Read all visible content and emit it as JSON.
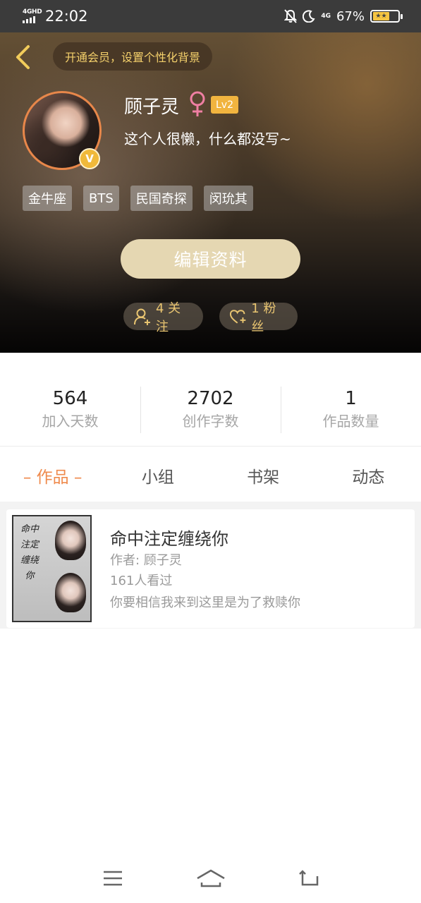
{
  "status_bar": {
    "network": "4GHD",
    "time": "22:02",
    "right_network": "4G",
    "battery_percent": "67%",
    "battery_level": 0.67,
    "battery_fill_color": "#f6c542"
  },
  "header": {
    "vip_banner": "开通会员，设置个性化背景",
    "username": "顾子灵",
    "gender_icon": "female-icon",
    "level": "Lv2",
    "bio": "这个人很懒，什么都没写~",
    "avatar_badge": "V",
    "tags": [
      "金牛座",
      "BTS",
      "民国奇探",
      "闵玧其"
    ],
    "edit_button": "编辑资料",
    "follow_count": "4 关注",
    "fans_count": "1 粉丝"
  },
  "stats": [
    {
      "value": "564",
      "label": "加入天数"
    },
    {
      "value": "2702",
      "label": "创作字数"
    },
    {
      "value": "1",
      "label": "作品数量"
    }
  ],
  "tabs": [
    {
      "label": "– 作品 –",
      "active": true
    },
    {
      "label": "小组",
      "active": false
    },
    {
      "label": "书架",
      "active": false
    },
    {
      "label": "动态",
      "active": false
    }
  ],
  "works": [
    {
      "title": "命中注定缠绕你",
      "author": "作者: 顾子灵",
      "views": "161人看过",
      "description": "你要相信我来到这里是为了救赎你",
      "cover_text": "命中注定缠绕你"
    }
  ],
  "colors": {
    "accent": "#ef8a4c",
    "vip_gold": "#f4d06b",
    "level_badge": "#f1b43f",
    "edit_button": "#e5d7b2"
  }
}
